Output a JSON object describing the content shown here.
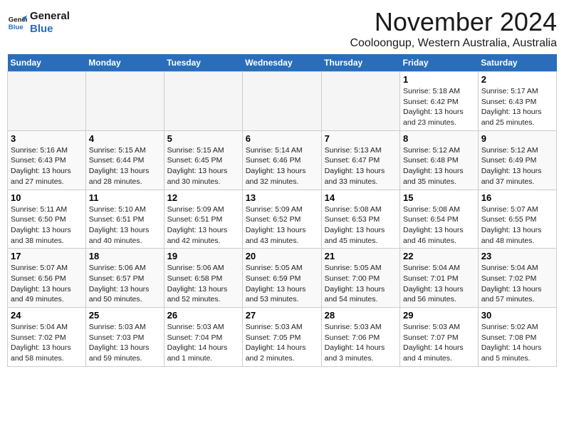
{
  "logo": {
    "line1": "General",
    "line2": "Blue"
  },
  "title": "November 2024",
  "location": "Cooloongup, Western Australia, Australia",
  "weekdays": [
    "Sunday",
    "Monday",
    "Tuesday",
    "Wednesday",
    "Thursday",
    "Friday",
    "Saturday"
  ],
  "weeks": [
    [
      {
        "day": "",
        "info": ""
      },
      {
        "day": "",
        "info": ""
      },
      {
        "day": "",
        "info": ""
      },
      {
        "day": "",
        "info": ""
      },
      {
        "day": "",
        "info": ""
      },
      {
        "day": "1",
        "info": "Sunrise: 5:18 AM\nSunset: 6:42 PM\nDaylight: 13 hours and 23 minutes."
      },
      {
        "day": "2",
        "info": "Sunrise: 5:17 AM\nSunset: 6:43 PM\nDaylight: 13 hours and 25 minutes."
      }
    ],
    [
      {
        "day": "3",
        "info": "Sunrise: 5:16 AM\nSunset: 6:43 PM\nDaylight: 13 hours and 27 minutes."
      },
      {
        "day": "4",
        "info": "Sunrise: 5:15 AM\nSunset: 6:44 PM\nDaylight: 13 hours and 28 minutes."
      },
      {
        "day": "5",
        "info": "Sunrise: 5:15 AM\nSunset: 6:45 PM\nDaylight: 13 hours and 30 minutes."
      },
      {
        "day": "6",
        "info": "Sunrise: 5:14 AM\nSunset: 6:46 PM\nDaylight: 13 hours and 32 minutes."
      },
      {
        "day": "7",
        "info": "Sunrise: 5:13 AM\nSunset: 6:47 PM\nDaylight: 13 hours and 33 minutes."
      },
      {
        "day": "8",
        "info": "Sunrise: 5:12 AM\nSunset: 6:48 PM\nDaylight: 13 hours and 35 minutes."
      },
      {
        "day": "9",
        "info": "Sunrise: 5:12 AM\nSunset: 6:49 PM\nDaylight: 13 hours and 37 minutes."
      }
    ],
    [
      {
        "day": "10",
        "info": "Sunrise: 5:11 AM\nSunset: 6:50 PM\nDaylight: 13 hours and 38 minutes."
      },
      {
        "day": "11",
        "info": "Sunrise: 5:10 AM\nSunset: 6:51 PM\nDaylight: 13 hours and 40 minutes."
      },
      {
        "day": "12",
        "info": "Sunrise: 5:09 AM\nSunset: 6:51 PM\nDaylight: 13 hours and 42 minutes."
      },
      {
        "day": "13",
        "info": "Sunrise: 5:09 AM\nSunset: 6:52 PM\nDaylight: 13 hours and 43 minutes."
      },
      {
        "day": "14",
        "info": "Sunrise: 5:08 AM\nSunset: 6:53 PM\nDaylight: 13 hours and 45 minutes."
      },
      {
        "day": "15",
        "info": "Sunrise: 5:08 AM\nSunset: 6:54 PM\nDaylight: 13 hours and 46 minutes."
      },
      {
        "day": "16",
        "info": "Sunrise: 5:07 AM\nSunset: 6:55 PM\nDaylight: 13 hours and 48 minutes."
      }
    ],
    [
      {
        "day": "17",
        "info": "Sunrise: 5:07 AM\nSunset: 6:56 PM\nDaylight: 13 hours and 49 minutes."
      },
      {
        "day": "18",
        "info": "Sunrise: 5:06 AM\nSunset: 6:57 PM\nDaylight: 13 hours and 50 minutes."
      },
      {
        "day": "19",
        "info": "Sunrise: 5:06 AM\nSunset: 6:58 PM\nDaylight: 13 hours and 52 minutes."
      },
      {
        "day": "20",
        "info": "Sunrise: 5:05 AM\nSunset: 6:59 PM\nDaylight: 13 hours and 53 minutes."
      },
      {
        "day": "21",
        "info": "Sunrise: 5:05 AM\nSunset: 7:00 PM\nDaylight: 13 hours and 54 minutes."
      },
      {
        "day": "22",
        "info": "Sunrise: 5:04 AM\nSunset: 7:01 PM\nDaylight: 13 hours and 56 minutes."
      },
      {
        "day": "23",
        "info": "Sunrise: 5:04 AM\nSunset: 7:02 PM\nDaylight: 13 hours and 57 minutes."
      }
    ],
    [
      {
        "day": "24",
        "info": "Sunrise: 5:04 AM\nSunset: 7:02 PM\nDaylight: 13 hours and 58 minutes."
      },
      {
        "day": "25",
        "info": "Sunrise: 5:03 AM\nSunset: 7:03 PM\nDaylight: 13 hours and 59 minutes."
      },
      {
        "day": "26",
        "info": "Sunrise: 5:03 AM\nSunset: 7:04 PM\nDaylight: 14 hours and 1 minute."
      },
      {
        "day": "27",
        "info": "Sunrise: 5:03 AM\nSunset: 7:05 PM\nDaylight: 14 hours and 2 minutes."
      },
      {
        "day": "28",
        "info": "Sunrise: 5:03 AM\nSunset: 7:06 PM\nDaylight: 14 hours and 3 minutes."
      },
      {
        "day": "29",
        "info": "Sunrise: 5:03 AM\nSunset: 7:07 PM\nDaylight: 14 hours and 4 minutes."
      },
      {
        "day": "30",
        "info": "Sunrise: 5:02 AM\nSunset: 7:08 PM\nDaylight: 14 hours and 5 minutes."
      }
    ]
  ]
}
